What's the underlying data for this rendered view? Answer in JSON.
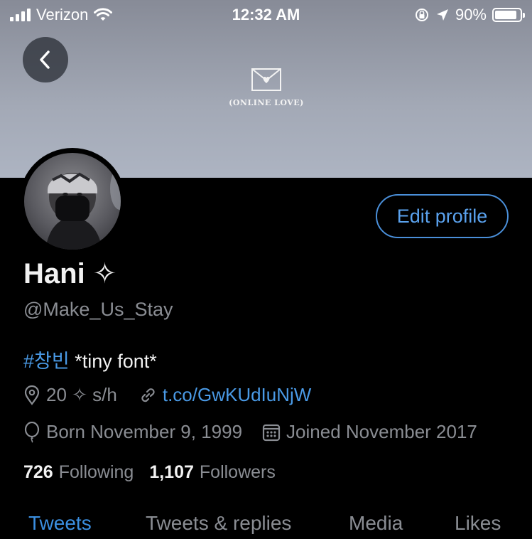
{
  "status_bar": {
    "carrier": "Verizon",
    "time": "12:32 AM",
    "battery": "90%",
    "battery_level": 0.9
  },
  "banner": {
    "logo_text": "(ONLINE LOVE)"
  },
  "profile": {
    "name": "Hani ✧",
    "handle": "@Make_Us_Stay",
    "edit_label": "Edit profile",
    "bio_hashtag": "#창빈",
    "bio_text": " *tiny font*",
    "location": "20 ✧ s/h",
    "link": "t.co/GwKUdIuNjW",
    "birthday": "Born November 9, 1999",
    "joined": "Joined November 2017",
    "following_count": "726",
    "following_label": "Following",
    "followers_count": "1,107",
    "followers_label": "Followers"
  },
  "tabs": [
    {
      "label": "Tweets",
      "active": true
    },
    {
      "label": "Tweets & replies",
      "active": false
    },
    {
      "label": "Media",
      "active": false
    },
    {
      "label": "Likes",
      "active": false
    }
  ],
  "colors": {
    "accent": "#4a9ae6",
    "background": "#000000",
    "muted": "#8a8d93"
  }
}
